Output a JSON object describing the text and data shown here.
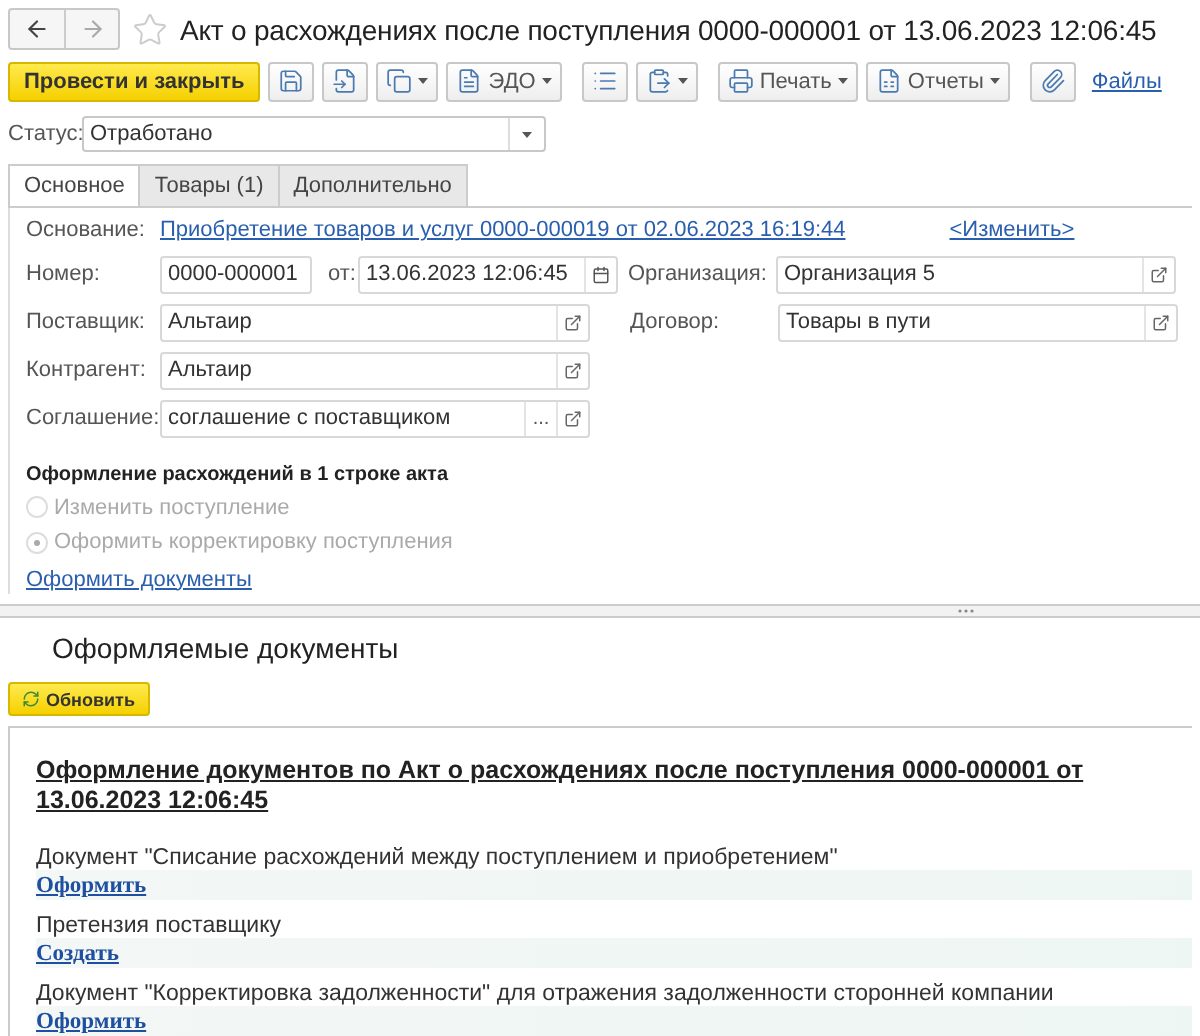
{
  "window": {
    "title": "Акт о расхождениях после поступления 0000-000001 от 13.06.2023 12:06:45"
  },
  "toolbar": [
    {
      "kind": "primary",
      "label": "Провести и закрыть"
    },
    {
      "kind": "icon"
    },
    {
      "kind": "icon"
    },
    {
      "kind": "icon-menu"
    },
    {
      "kind": "menu",
      "label": "ЭДО"
    },
    {
      "kind": "icon"
    },
    {
      "kind": "icon-menu"
    },
    {
      "kind": "menu",
      "label": "Печать"
    },
    {
      "kind": "menu",
      "label": "Отчеты"
    },
    {
      "kind": "icon"
    },
    {
      "kind": "link",
      "label": "Файлы"
    }
  ],
  "status": {
    "label": "Статус:",
    "value": "Отработано"
  },
  "tabs": [
    {
      "label": "Основное",
      "selected": true
    },
    {
      "label": "Товары (1)",
      "selected": false
    },
    {
      "label": "Дополнительно",
      "selected": false
    }
  ],
  "basis": {
    "label": "Основание:",
    "link": "Приобретение товаров и услуг 0000-000019 от 02.06.2023 16:19:44",
    "change": "<Изменить>"
  },
  "number": {
    "label": "Номер:",
    "value": "0000-000001"
  },
  "date": {
    "label": "от:",
    "value": "13.06.2023 12:06:45"
  },
  "organization": {
    "label": "Организация:",
    "value": "Организация 5"
  },
  "supplier": {
    "label": "Поставщик:",
    "value": "Альтаир"
  },
  "contract": {
    "label": "Договор:",
    "value": "Товары в пути"
  },
  "counterparty": {
    "label": "Контрагент:",
    "value": "Альтаир"
  },
  "agreement": {
    "label": "Соглашение:",
    "value": "соглашение с поставщиком",
    "choose": "..."
  },
  "discrepancy": {
    "title": "Оформление расхождений в 1 строке акта",
    "options": [
      {
        "label": "Изменить поступление",
        "selected": false,
        "disabled": true
      },
      {
        "label": "Оформить корректировку поступления",
        "selected": true,
        "disabled": true
      }
    ]
  },
  "make_documents": "Оформить документы",
  "documents_panel": {
    "title": "Оформляемые документы",
    "refresh": "Обновить",
    "heading": "Оформление документов по Акт о расхождениях после поступления 0000-000001 от 13.06.2023 12:06:45",
    "items": [
      {
        "text": "Документ \"Списание расхождений между поступлением и приобретением\"",
        "action": "Оформить"
      },
      {
        "text": "Претензия поставщику",
        "action": "Создать"
      },
      {
        "text": "Документ \"Корректировка задолженности\" для отражения задолженности сторонней компании",
        "action": "Оформить"
      }
    ]
  }
}
